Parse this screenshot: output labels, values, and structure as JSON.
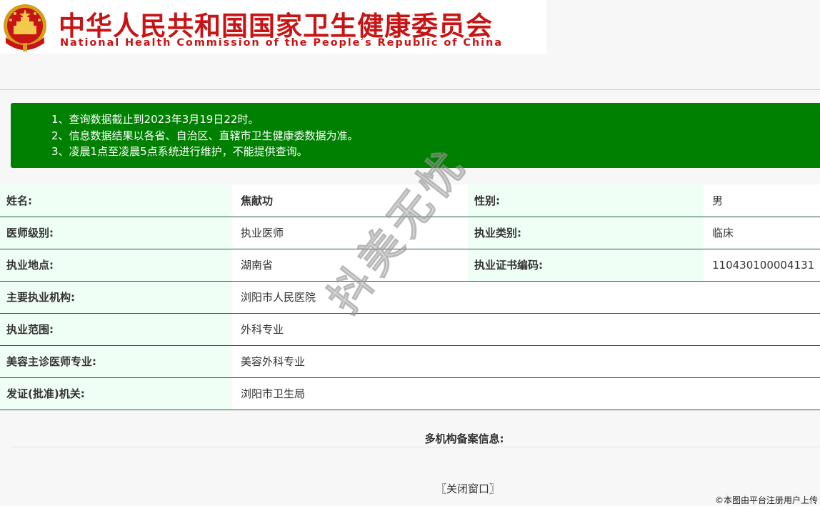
{
  "header": {
    "title_cn": "中华人民共和国国家卫生健康委员会",
    "title_en": "National Health Commission of the People′s Republic of China",
    "emblem_icon": "national-emblem-icon",
    "title_color": "#c81414"
  },
  "notice": {
    "lines": [
      "1、查询数据截止到2023年3月19日22时。",
      "2、信息数据结果以各省、自治区、直辖市卫生健康委数据为准。",
      "3、凌晨1点至凌晨5点系统进行维护，不能提供查询。"
    ],
    "background": "#008000"
  },
  "doctor": {
    "name_label": "姓名:",
    "name": "焦献功",
    "gender_label": "性别:",
    "gender": "男",
    "level_label": "医师级别:",
    "level": "执业医师",
    "category_label": "执业类别:",
    "category": "临床",
    "location_label": "执业地点:",
    "location": "湖南省",
    "cert_label": "执业证书编码:",
    "cert_no": "110430100004131",
    "institution_label": "主要执业机构:",
    "institution": "浏阳市人民医院",
    "scope_label": "执业范围:",
    "scope": "外科专业",
    "cosmetic_label": "美容主诊医师专业:",
    "cosmetic": "美容外科专业",
    "authority_label": "发证(批准)机关:",
    "authority": "浏阳市卫生局"
  },
  "multi_record_label": "多机构备案信息:",
  "close_button": "〖关闭窗口〗",
  "watermark": "抖美无忧",
  "credit": "©本图由平台注册用户上传"
}
